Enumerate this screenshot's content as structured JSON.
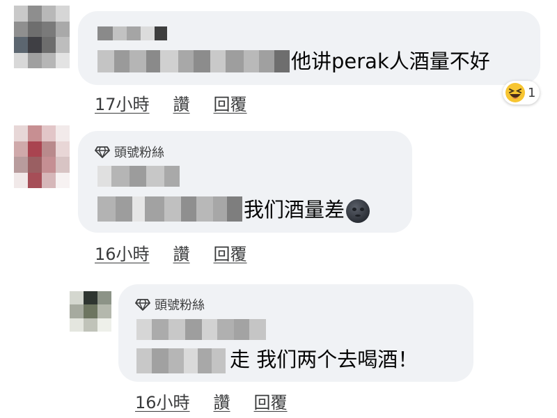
{
  "comments": [
    {
      "badge": "",
      "text": "他讲perak人酒量不好",
      "timestamp": "17小時",
      "like_label": "讚",
      "reply_label": "回覆",
      "reaction": {
        "icon": "laughing-emoji-icon",
        "count": "1"
      }
    },
    {
      "badge": "頭號粉絲",
      "text": "我们酒量差",
      "emoji": "new-moon-face-icon",
      "timestamp": "16小時",
      "like_label": "讚",
      "reply_label": "回覆"
    },
    {
      "badge": "頭號粉絲",
      "text": "走 我们两个去喝酒！",
      "timestamp": "16小時",
      "like_label": "讚",
      "reply_label": "回覆"
    }
  ],
  "colors": {
    "bubble": "#f0f2f5",
    "meta_text": "#3a3b3c"
  }
}
